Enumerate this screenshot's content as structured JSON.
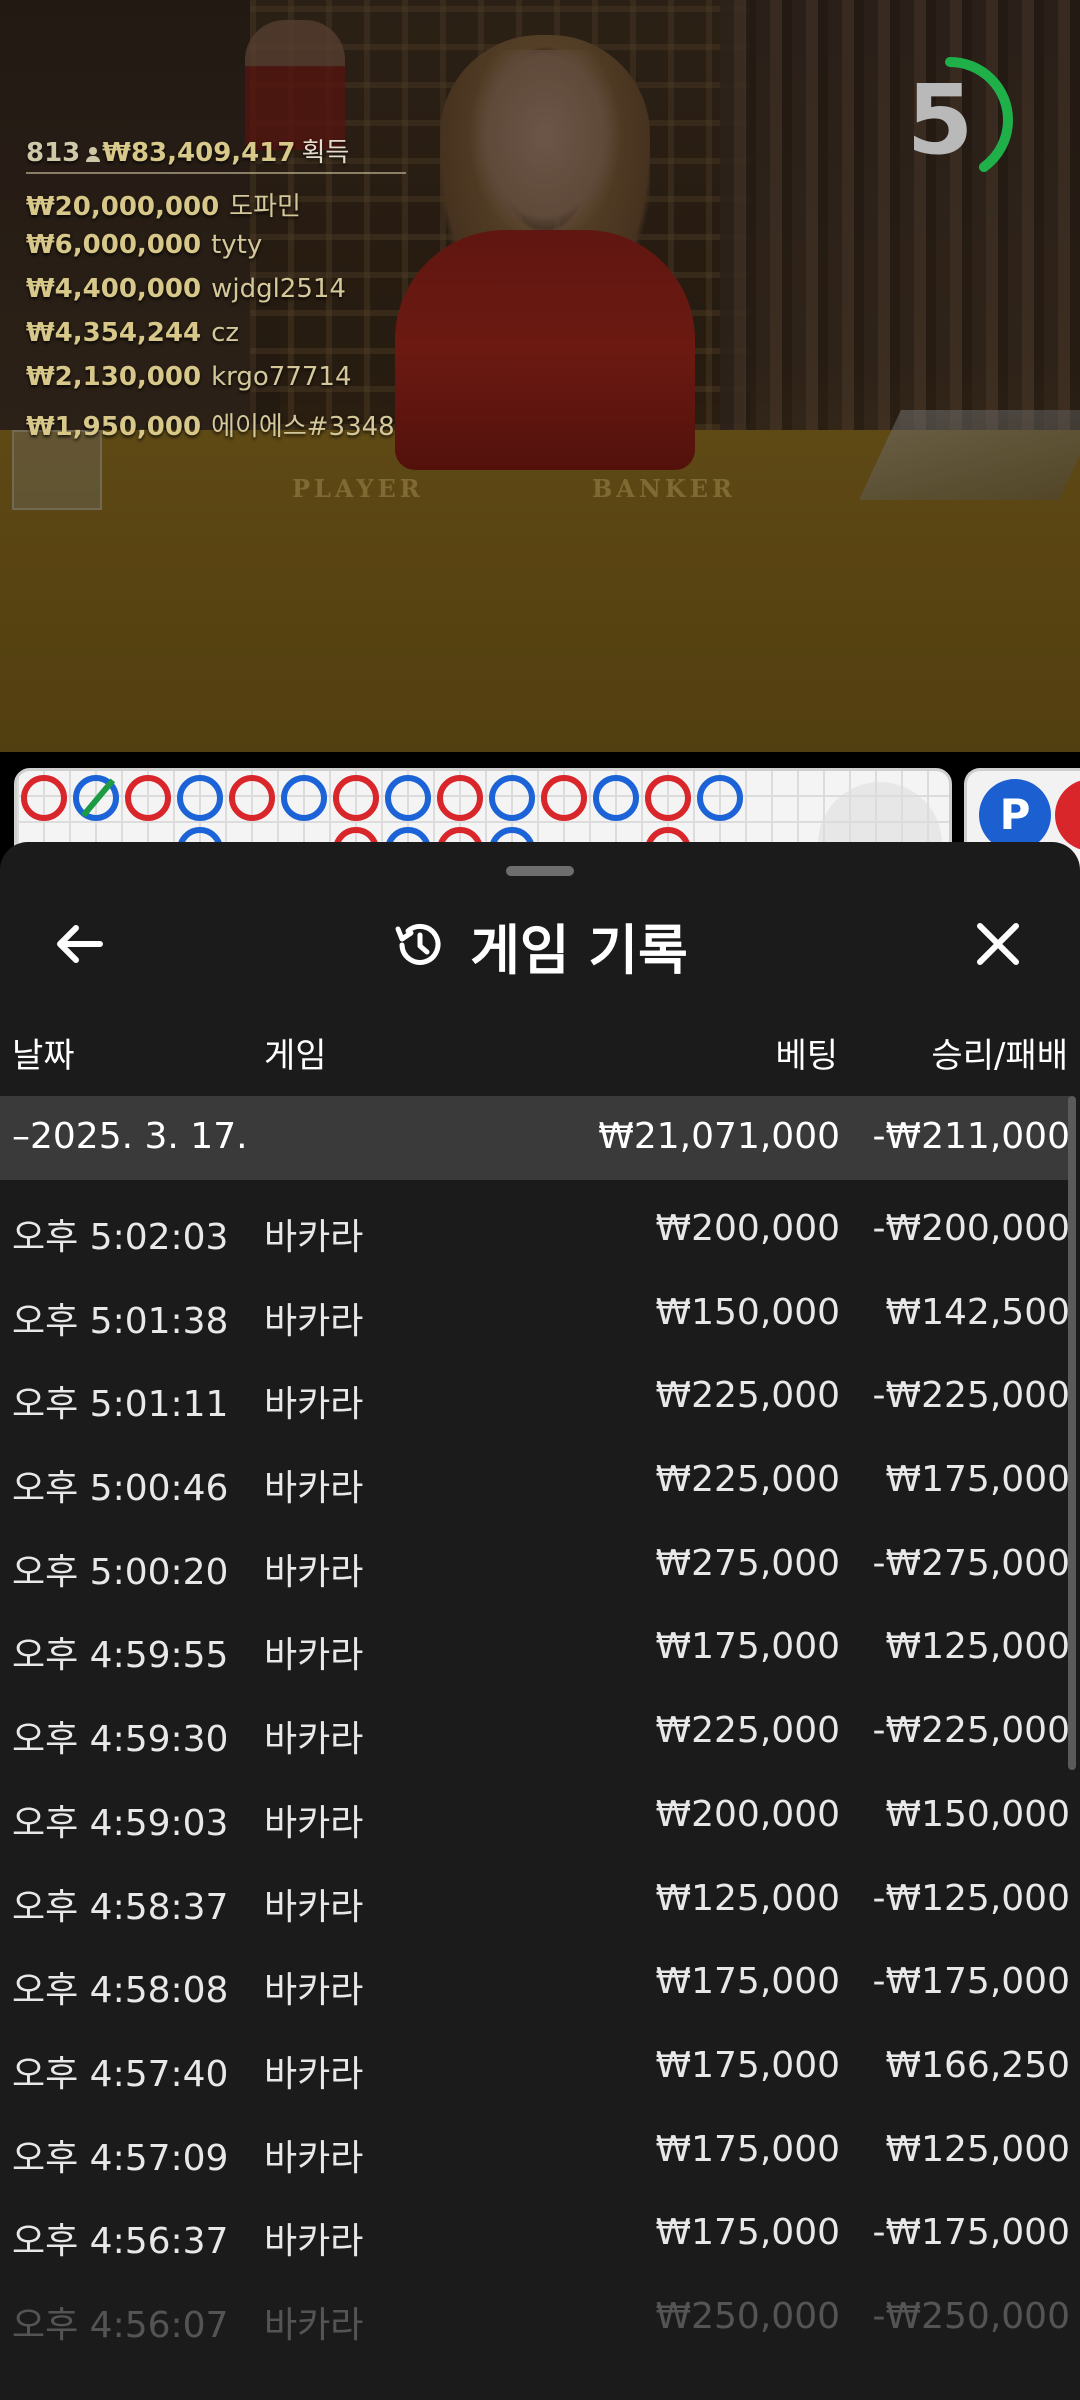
{
  "overlay": {
    "viewer_count": "813",
    "total_won": "₩83,409,417",
    "total_won_label": "획득",
    "timer_value": "5",
    "timer_progress": 0.4,
    "winners": [
      {
        "amount": "₩20,000,000",
        "name": "도파민"
      },
      {
        "amount": "₩6,000,000",
        "name": "tyty"
      },
      {
        "amount": "₩4,400,000",
        "name": "wjdgl2514"
      },
      {
        "amount": "₩4,354,244",
        "name": "cz"
      },
      {
        "amount": "₩2,130,000",
        "name": "krgo77714"
      },
      {
        "amount": "₩1,950,000",
        "name": "에이에스#3348"
      }
    ],
    "table_labels": {
      "player": "PLAYER",
      "banker": "BANKER"
    },
    "side_badge": "P"
  },
  "colors": {
    "banker": "#d8262b",
    "player": "#1b63d6",
    "tie": "#1c9a44",
    "sheet_bg": "#1b1b1b",
    "summary_bg": "#3a3a3a",
    "timer_arc": "#20b04a"
  },
  "sheet": {
    "title": "게임 기록",
    "back_icon": "arrow-left-icon",
    "history_icon": "history-clock-icon",
    "close_icon": "close-icon",
    "columns": {
      "date": "날짜",
      "game": "게임",
      "bet": "베팅",
      "win_loss": "승리/패배"
    },
    "summary": {
      "date": "–2025. 3. 17.",
      "bet": "₩21,071,000",
      "win_loss": "-₩211,000"
    },
    "rows": [
      {
        "time": "오후 5:02:03",
        "game": "바카라",
        "bet": "₩200,000",
        "win_loss": "-₩200,000"
      },
      {
        "time": "오후 5:01:38",
        "game": "바카라",
        "bet": "₩150,000",
        "win_loss": "₩142,500"
      },
      {
        "time": "오후 5:01:11",
        "game": "바카라",
        "bet": "₩225,000",
        "win_loss": "-₩225,000"
      },
      {
        "time": "오후 5:00:46",
        "game": "바카라",
        "bet": "₩225,000",
        "win_loss": "₩175,000"
      },
      {
        "time": "오후 5:00:20",
        "game": "바카라",
        "bet": "₩275,000",
        "win_loss": "-₩275,000"
      },
      {
        "time": "오후 4:59:55",
        "game": "바카라",
        "bet": "₩175,000",
        "win_loss": "₩125,000"
      },
      {
        "time": "오후 4:59:30",
        "game": "바카라",
        "bet": "₩225,000",
        "win_loss": "-₩225,000"
      },
      {
        "time": "오후 4:59:03",
        "game": "바카라",
        "bet": "₩200,000",
        "win_loss": "₩150,000"
      },
      {
        "time": "오후 4:58:37",
        "game": "바카라",
        "bet": "₩125,000",
        "win_loss": "-₩125,000"
      },
      {
        "time": "오후 4:58:08",
        "game": "바카라",
        "bet": "₩175,000",
        "win_loss": "-₩175,000"
      },
      {
        "time": "오후 4:57:40",
        "game": "바카라",
        "bet": "₩175,000",
        "win_loss": "₩166,250"
      },
      {
        "time": "오후 4:57:09",
        "game": "바카라",
        "bet": "₩175,000",
        "win_loss": "₩125,000"
      },
      {
        "time": "오후 4:56:37",
        "game": "바카라",
        "bet": "₩175,000",
        "win_loss": "-₩175,000"
      },
      {
        "time": "오후 4:56:07",
        "game": "바카라",
        "bet": "₩250,000",
        "win_loss": "-₩250,000"
      }
    ]
  },
  "roadmap": {
    "top_row": [
      "B",
      "P-tie",
      "B",
      "P",
      "B",
      "P",
      "B",
      "P",
      "B",
      "P",
      "B",
      "P",
      "B",
      "P"
    ],
    "second_row": [
      "",
      "",
      "",
      "P",
      "",
      "",
      "B",
      "P",
      "B",
      "P",
      "",
      "",
      "B",
      ""
    ]
  }
}
